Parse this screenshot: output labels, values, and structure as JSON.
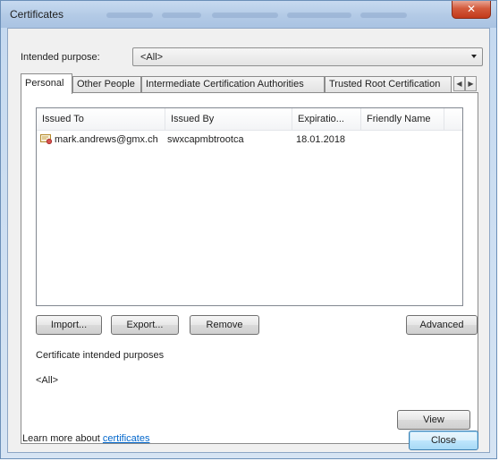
{
  "window": {
    "title": "Certificates",
    "close_glyph": "✕"
  },
  "purpose": {
    "label": "Intended purpose:",
    "value": "<All>"
  },
  "tabs": [
    {
      "label": "Personal"
    },
    {
      "label": "Other People"
    },
    {
      "label": "Intermediate Certification Authorities"
    },
    {
      "label": "Trusted Root Certification"
    }
  ],
  "tab_scroll": {
    "left": "◀",
    "right": "▶"
  },
  "table": {
    "columns": [
      "Issued To",
      "Issued By",
      "Expiratio...",
      "Friendly Name"
    ],
    "rows": [
      {
        "issued_to": "mark.andrews@gmx.ch",
        "issued_by": "swxcapmbtrootca",
        "expiration": "18.01.2018",
        "friendly_name": ""
      }
    ]
  },
  "buttons": {
    "import": "Import...",
    "export": "Export...",
    "remove": "Remove",
    "advanced": "Advanced",
    "view": "View",
    "close": "Close"
  },
  "purposes_section": {
    "heading": "Certificate intended purposes",
    "value": "<All>"
  },
  "learn_more": {
    "prefix": "Learn more about",
    "link": "certificates"
  },
  "icons": {
    "cert_row": "certificate-icon",
    "dropdown": "chevron-down-icon"
  },
  "colors": {
    "titlebar": "#b3cae6",
    "close_button": "#c2391b",
    "link": "#0066cc",
    "default_button_border": "#3c7fb1"
  }
}
